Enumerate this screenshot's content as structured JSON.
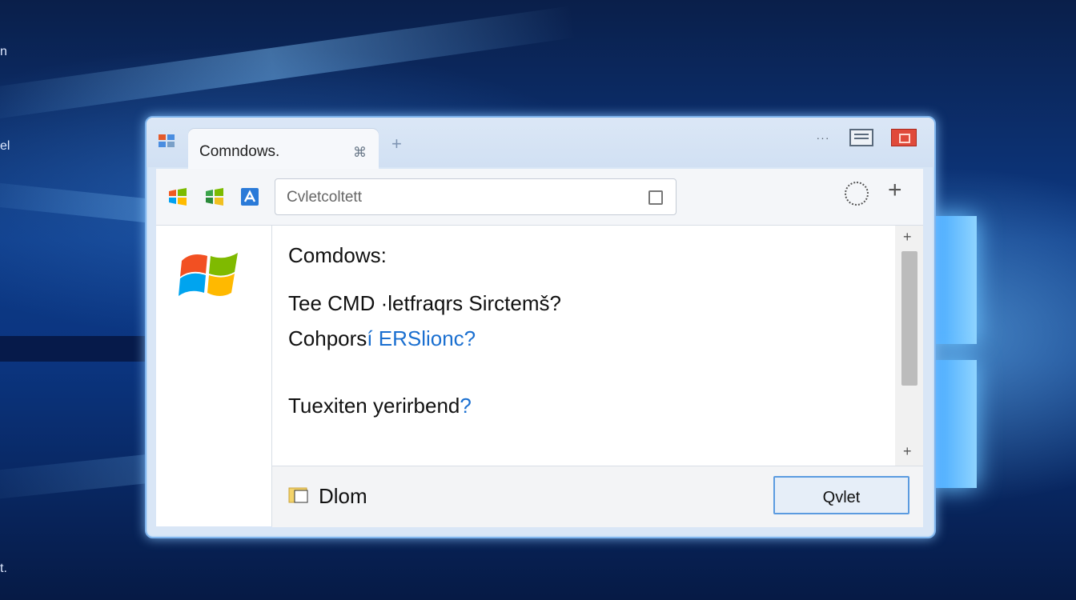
{
  "desktop": {
    "edge_texts": [
      "n",
      "el",
      "t."
    ]
  },
  "window": {
    "tab_title": "Comndows.",
    "tab_icon": "pin-icon",
    "new_tab_glyph": "+",
    "min_glyph": "···",
    "colors": {
      "accent": "#5b9be0",
      "close": "#e04a3a"
    }
  },
  "toolbar": {
    "address_value": "Cvletcoltett",
    "plus_glyph": "+"
  },
  "content": {
    "heading": "Comdows:",
    "line1": "Tee CMD ·letfraqrs Sirctemš?",
    "line2_main": "Cohpors",
    "line2_mid": "í ERSlionc",
    "line2_q": "?",
    "line3_main": "Tuexiten yeri",
    "line3_mid": "rbend",
    "line3_q": "?"
  },
  "scrollbar": {
    "up": "+",
    "down": "+"
  },
  "footer": {
    "label": "Dlom",
    "quit_label": "Qvlet"
  }
}
